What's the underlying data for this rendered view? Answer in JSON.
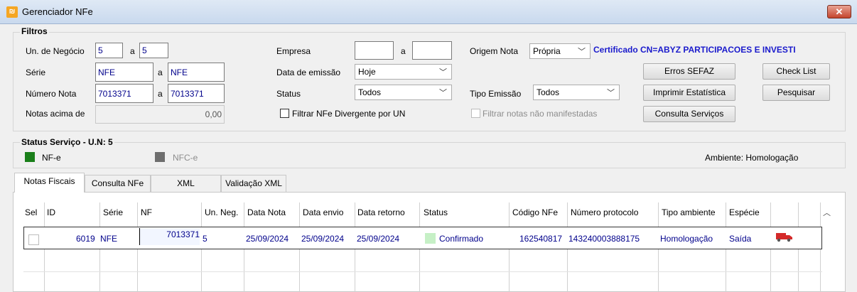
{
  "window": {
    "title": "Gerenciador NFe",
    "close_glyph": "✕",
    "app_icon_glyph": "₪"
  },
  "filtros": {
    "legend": "Filtros",
    "un_negocio": {
      "label": "Un. de Negócio",
      "from": "5",
      "sep": "a",
      "to": "5"
    },
    "serie": {
      "label": "Série",
      "from": "NFE",
      "sep": "a",
      "to": "NFE"
    },
    "numero_nota": {
      "label": "Número Nota",
      "from": "7013371",
      "sep": "a",
      "to": "7013371"
    },
    "notas_acima": {
      "label": "Notas acima de",
      "value": "0,00"
    },
    "empresa": {
      "label": "Empresa",
      "from": "",
      "sep": "a",
      "to": ""
    },
    "data_emissao": {
      "label": "Data de emissão",
      "value": "Hoje"
    },
    "status": {
      "label": "Status",
      "value": "Todos"
    },
    "filtrar_divergente": {
      "label": "Filtrar NFe Divergente por UN",
      "checked": false
    },
    "origem_nota": {
      "label": "Origem Nota",
      "value": "Própria"
    },
    "certificado": "Certificado CN=ABYZ PARTICIPACOES E INVESTI",
    "tipo_emissao": {
      "label": "Tipo Emissão",
      "value": "Todos"
    },
    "filtrar_nao_manifestadas": {
      "label": "Filtrar notas não manifestadas",
      "checked": false
    },
    "buttons": {
      "erros_sefaz": "Erros SEFAZ",
      "check_list": "Check List",
      "imprimir": "Imprimir Estatística",
      "pesquisar": "Pesquisar",
      "consulta_servicos": "Consulta Serviços"
    }
  },
  "status_servico": {
    "legend": "Status Serviço - U.N: 5",
    "nfe_label": "NF-e",
    "nfce_label": "NFC-e",
    "ambiente": "Ambiente: Homologação",
    "colors": {
      "nfe": "#1a7f1a",
      "nfce": "#6e6e6e"
    }
  },
  "tabs": [
    "Notas Fiscais",
    "Consulta NFe",
    "XML",
    "Validação XML"
  ],
  "grid": {
    "columns": [
      "Sel",
      "ID",
      "Série",
      "NF",
      "Un. Neg.",
      "Data Nota",
      "Data envio",
      "Data retorno",
      "Status",
      "Código NFe",
      "Número protocolo",
      "Tipo ambiente",
      "Espécie"
    ],
    "rows": [
      {
        "id": "6019",
        "serie": "NFE",
        "nf": "7013371",
        "un_neg": "5",
        "data_nota": "25/09/2024",
        "data_envio": "25/09/2024",
        "data_retorno": "25/09/2024",
        "status": "Confirmado",
        "status_color": "#c6f0c6",
        "codigo_nfe": "162540817",
        "protocolo": "143240003888175",
        "tipo_ambiente": "Homologação",
        "especie": "Saída",
        "truck_icon": "truck-icon"
      }
    ]
  }
}
